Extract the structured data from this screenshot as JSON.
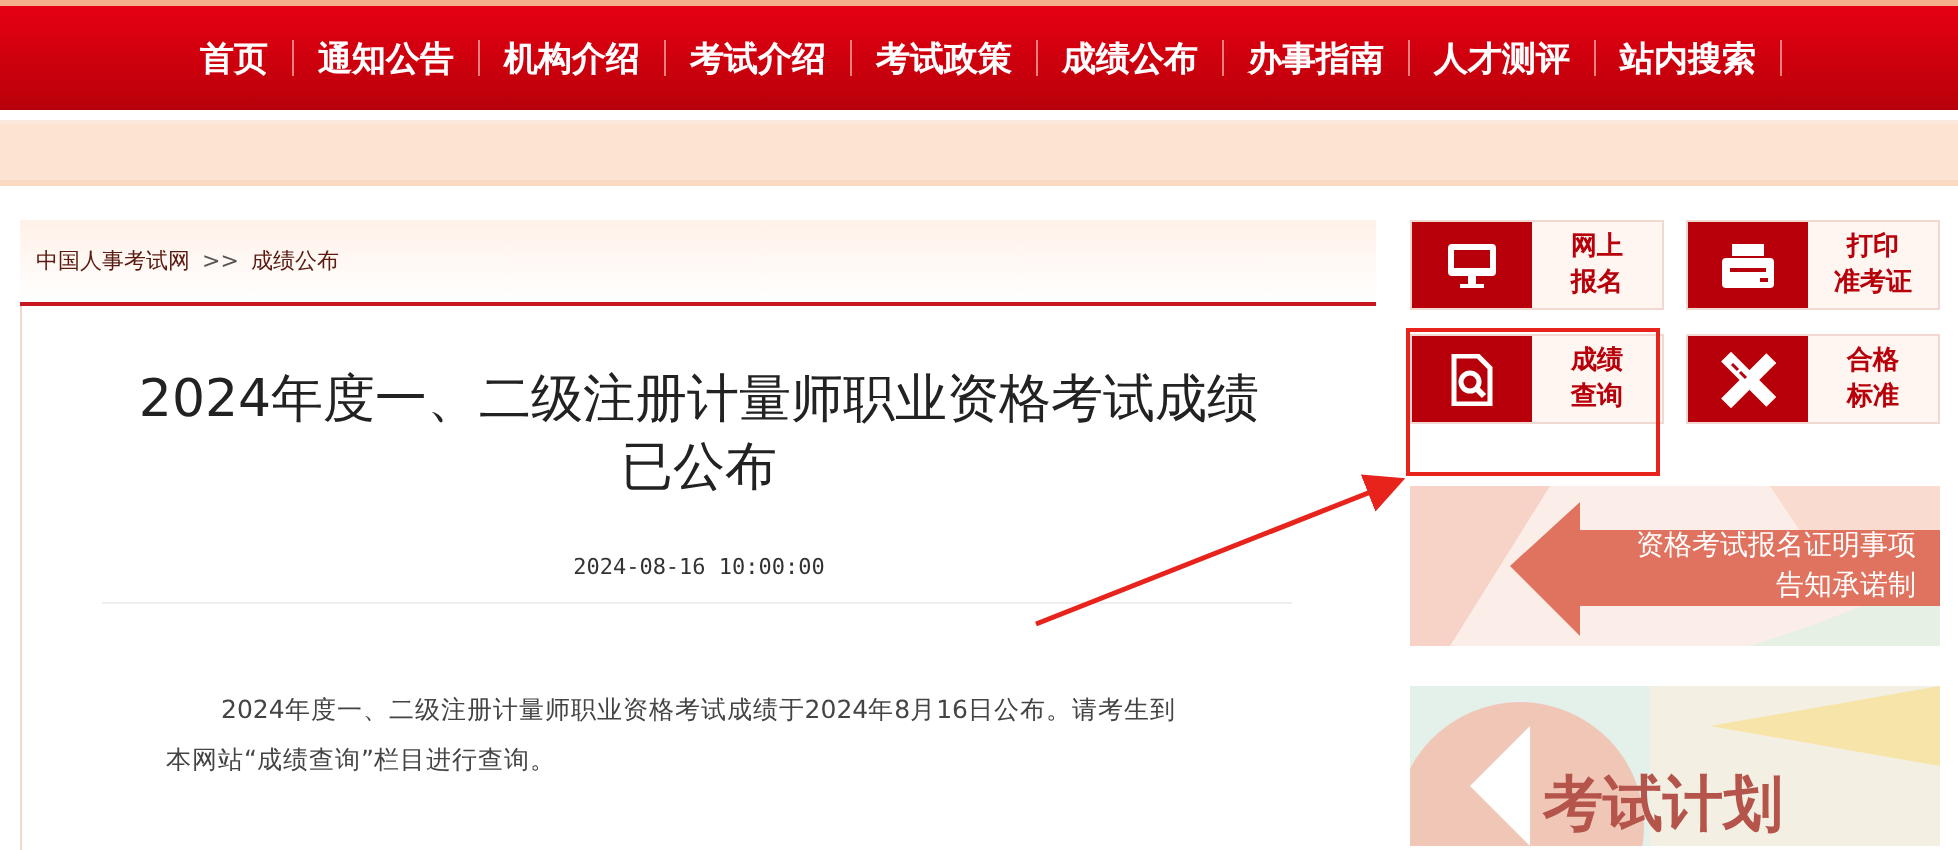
{
  "nav": [
    "首页",
    "通知公告",
    "机构介绍",
    "考试介绍",
    "考试政策",
    "成绩公布",
    "办事指南",
    "人才测评",
    "站内搜索"
  ],
  "breadcrumb": {
    "items": [
      "中国人事考试网",
      "成绩公布"
    ],
    "separator": ">>"
  },
  "article": {
    "title": "2024年度一、二级注册计量师职业资格考试成绩已公布",
    "date": "2024-08-16 10:00:00",
    "body": "2024年度一、二级注册计量师职业资格考试成绩于2024年8月16日公布。请考生到本网站“成绩查询”栏目进行查询。"
  },
  "quick_links": [
    {
      "kind": "monitor",
      "lines": [
        "网上",
        "报名"
      ],
      "highlighted": false
    },
    {
      "kind": "printer",
      "lines": [
        "打印",
        "准考证"
      ],
      "highlighted": false
    },
    {
      "kind": "search-doc",
      "lines": [
        "成绩",
        "查询"
      ],
      "highlighted": true
    },
    {
      "kind": "tools",
      "lines": [
        "合格",
        "标准"
      ],
      "highlighted": false
    }
  ],
  "banners": [
    {
      "kind": "arrow-banner",
      "lines": [
        "资格考试报名证明事项",
        "告知承诺制"
      ]
    },
    {
      "kind": "plan-banner",
      "lines": [
        "考试计划"
      ]
    }
  ]
}
